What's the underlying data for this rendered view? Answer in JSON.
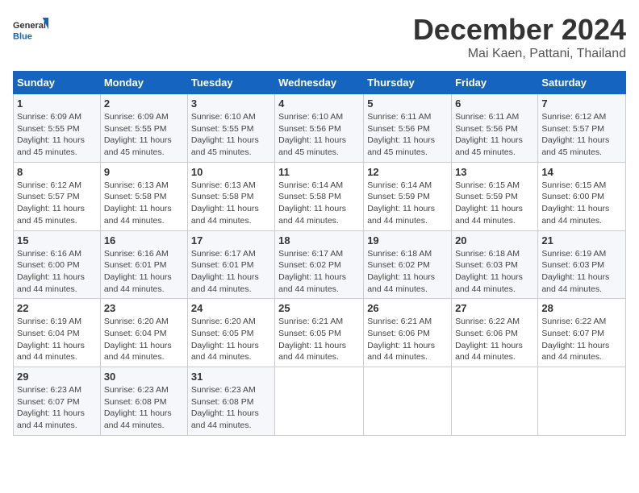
{
  "header": {
    "logo_general": "General",
    "logo_blue": "Blue",
    "month_title": "December 2024",
    "location": "Mai Kaen, Pattani, Thailand"
  },
  "weekdays": [
    "Sunday",
    "Monday",
    "Tuesday",
    "Wednesday",
    "Thursday",
    "Friday",
    "Saturday"
  ],
  "weeks": [
    [
      {
        "day": "1",
        "sunrise": "6:09 AM",
        "sunset": "5:55 PM",
        "daylight": "11 hours and 45 minutes."
      },
      {
        "day": "2",
        "sunrise": "6:09 AM",
        "sunset": "5:55 PM",
        "daylight": "11 hours and 45 minutes."
      },
      {
        "day": "3",
        "sunrise": "6:10 AM",
        "sunset": "5:55 PM",
        "daylight": "11 hours and 45 minutes."
      },
      {
        "day": "4",
        "sunrise": "6:10 AM",
        "sunset": "5:56 PM",
        "daylight": "11 hours and 45 minutes."
      },
      {
        "day": "5",
        "sunrise": "6:11 AM",
        "sunset": "5:56 PM",
        "daylight": "11 hours and 45 minutes."
      },
      {
        "day": "6",
        "sunrise": "6:11 AM",
        "sunset": "5:56 PM",
        "daylight": "11 hours and 45 minutes."
      },
      {
        "day": "7",
        "sunrise": "6:12 AM",
        "sunset": "5:57 PM",
        "daylight": "11 hours and 45 minutes."
      }
    ],
    [
      {
        "day": "8",
        "sunrise": "6:12 AM",
        "sunset": "5:57 PM",
        "daylight": "11 hours and 45 minutes."
      },
      {
        "day": "9",
        "sunrise": "6:13 AM",
        "sunset": "5:58 PM",
        "daylight": "11 hours and 44 minutes."
      },
      {
        "day": "10",
        "sunrise": "6:13 AM",
        "sunset": "5:58 PM",
        "daylight": "11 hours and 44 minutes."
      },
      {
        "day": "11",
        "sunrise": "6:14 AM",
        "sunset": "5:58 PM",
        "daylight": "11 hours and 44 minutes."
      },
      {
        "day": "12",
        "sunrise": "6:14 AM",
        "sunset": "5:59 PM",
        "daylight": "11 hours and 44 minutes."
      },
      {
        "day": "13",
        "sunrise": "6:15 AM",
        "sunset": "5:59 PM",
        "daylight": "11 hours and 44 minutes."
      },
      {
        "day": "14",
        "sunrise": "6:15 AM",
        "sunset": "6:00 PM",
        "daylight": "11 hours and 44 minutes."
      }
    ],
    [
      {
        "day": "15",
        "sunrise": "6:16 AM",
        "sunset": "6:00 PM",
        "daylight": "11 hours and 44 minutes."
      },
      {
        "day": "16",
        "sunrise": "6:16 AM",
        "sunset": "6:01 PM",
        "daylight": "11 hours and 44 minutes."
      },
      {
        "day": "17",
        "sunrise": "6:17 AM",
        "sunset": "6:01 PM",
        "daylight": "11 hours and 44 minutes."
      },
      {
        "day": "18",
        "sunrise": "6:17 AM",
        "sunset": "6:02 PM",
        "daylight": "11 hours and 44 minutes."
      },
      {
        "day": "19",
        "sunrise": "6:18 AM",
        "sunset": "6:02 PM",
        "daylight": "11 hours and 44 minutes."
      },
      {
        "day": "20",
        "sunrise": "6:18 AM",
        "sunset": "6:03 PM",
        "daylight": "11 hours and 44 minutes."
      },
      {
        "day": "21",
        "sunrise": "6:19 AM",
        "sunset": "6:03 PM",
        "daylight": "11 hours and 44 minutes."
      }
    ],
    [
      {
        "day": "22",
        "sunrise": "6:19 AM",
        "sunset": "6:04 PM",
        "daylight": "11 hours and 44 minutes."
      },
      {
        "day": "23",
        "sunrise": "6:20 AM",
        "sunset": "6:04 PM",
        "daylight": "11 hours and 44 minutes."
      },
      {
        "day": "24",
        "sunrise": "6:20 AM",
        "sunset": "6:05 PM",
        "daylight": "11 hours and 44 minutes."
      },
      {
        "day": "25",
        "sunrise": "6:21 AM",
        "sunset": "6:05 PM",
        "daylight": "11 hours and 44 minutes."
      },
      {
        "day": "26",
        "sunrise": "6:21 AM",
        "sunset": "6:06 PM",
        "daylight": "11 hours and 44 minutes."
      },
      {
        "day": "27",
        "sunrise": "6:22 AM",
        "sunset": "6:06 PM",
        "daylight": "11 hours and 44 minutes."
      },
      {
        "day": "28",
        "sunrise": "6:22 AM",
        "sunset": "6:07 PM",
        "daylight": "11 hours and 44 minutes."
      }
    ],
    [
      {
        "day": "29",
        "sunrise": "6:23 AM",
        "sunset": "6:07 PM",
        "daylight": "11 hours and 44 minutes."
      },
      {
        "day": "30",
        "sunrise": "6:23 AM",
        "sunset": "6:08 PM",
        "daylight": "11 hours and 44 minutes."
      },
      {
        "day": "31",
        "sunrise": "6:23 AM",
        "sunset": "6:08 PM",
        "daylight": "11 hours and 44 minutes."
      },
      null,
      null,
      null,
      null
    ]
  ]
}
